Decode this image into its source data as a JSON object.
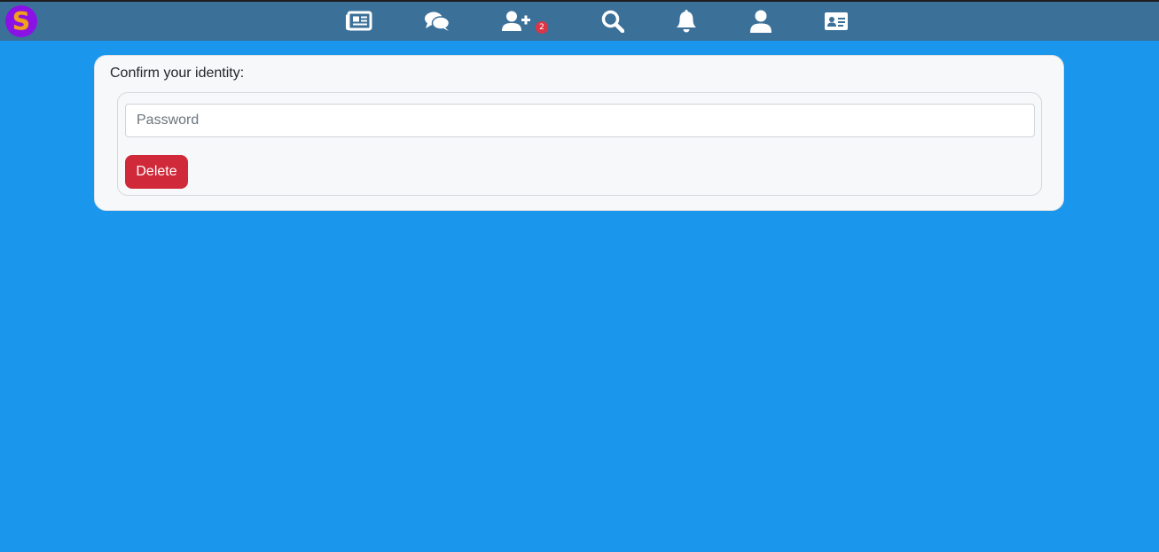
{
  "app": {
    "logo_letter": "S",
    "logo_color": "#8a12e6",
    "logo_letter_color": "#f2a11d"
  },
  "nav": {
    "items": [
      {
        "icon": "newspaper-icon"
      },
      {
        "icon": "comments-icon"
      },
      {
        "icon": "user-plus-icon",
        "badge": "2"
      },
      {
        "icon": "search-icon"
      },
      {
        "icon": "bell-icon"
      },
      {
        "icon": "user-icon"
      },
      {
        "icon": "id-card-icon"
      }
    ],
    "bar_color": "#3b7099"
  },
  "form": {
    "title": "Confirm your identity:",
    "password_placeholder": "Password",
    "password_value": "",
    "delete_label": "Delete",
    "delete_color": "#d0293a"
  },
  "page": {
    "background": "#1a96ec"
  }
}
